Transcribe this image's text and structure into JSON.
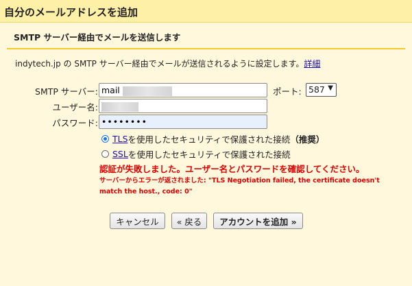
{
  "title": "自分のメールアドレスを追加",
  "section_heading": "SMTP サーバー経由でメールを送信します",
  "intro": {
    "text": "indytech.jp の SMTP サーバー経由でメールが送信されるように設定します。",
    "link": "詳細"
  },
  "form": {
    "server_label": "SMTP サーバー:",
    "server_value": "mail",
    "port_label": "ポート:",
    "port_value": "587",
    "username_label": "ユーザー名:",
    "username_value": "",
    "password_label": "パスワード:",
    "password_value": "••••••••",
    "tls_link": "TLS",
    "tls_text": " を使用したセキュリティで保護された接続",
    "tls_recommended": "（推奨）",
    "tls_selected": true,
    "ssl_link": "SSL",
    "ssl_text": " を使用したセキュリティで保護された接続",
    "ssl_selected": false
  },
  "errors": {
    "main": "認証が失敗しました。ユーザー名とパスワードを確認してください。",
    "detail": "サーバーからエラーが返されました: \"TLS Negotiation failed, the certificate doesn't match the host., code: 0\""
  },
  "buttons": {
    "cancel": "キャンセル",
    "back": "« 戻る",
    "add": "アカウントを追加 »"
  },
  "colors": {
    "background": "#fff8dc",
    "title_bar": "#fff0a8",
    "divider": "#f7c928",
    "error": "#dd0000",
    "link": "#1a0dab"
  }
}
